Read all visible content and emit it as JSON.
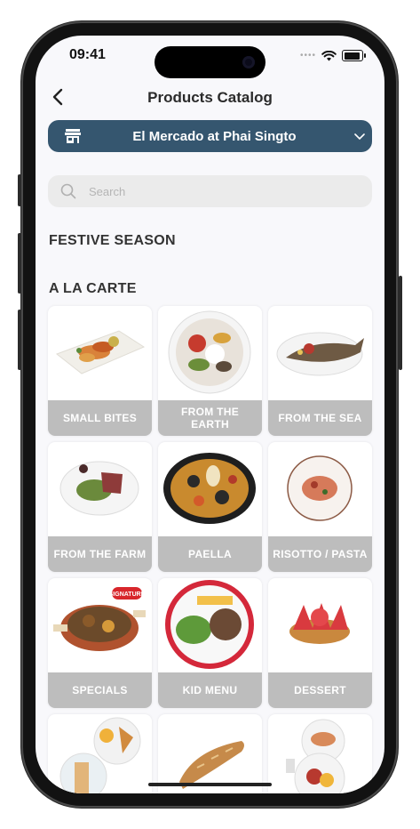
{
  "status_bar": {
    "time": "09:41"
  },
  "header": {
    "title": "Products Catalog"
  },
  "store_selector": {
    "name": "El Mercado at Phai Singto"
  },
  "search": {
    "placeholder": "Search"
  },
  "sections": {
    "festive": "FESTIVE SEASON",
    "alacarte": "A LA CARTE"
  },
  "categories": [
    {
      "label": "SMALL BITES",
      "image": "small-bites-plate"
    },
    {
      "label": "FROM THE EARTH",
      "image": "salad-bowl"
    },
    {
      "label": "FROM THE SEA",
      "image": "grilled-fish"
    },
    {
      "label": "FROM THE FARM",
      "image": "steak-plate"
    },
    {
      "label": "PAELLA",
      "image": "paella-pan"
    },
    {
      "label": "RISOTTO / PASTA",
      "image": "pasta-plate"
    },
    {
      "label": "SPECIALS",
      "image": "specials-dish",
      "badge": "SIGNATURE"
    },
    {
      "label": "KID MENU",
      "image": "burger-fries-plate"
    },
    {
      "label": "DESSERT",
      "image": "strawberry-tart"
    },
    {
      "label": "",
      "image": "breakfast-plates"
    },
    {
      "label": "",
      "image": "baguette"
    },
    {
      "label": "",
      "image": "brunch-plates"
    }
  ]
}
